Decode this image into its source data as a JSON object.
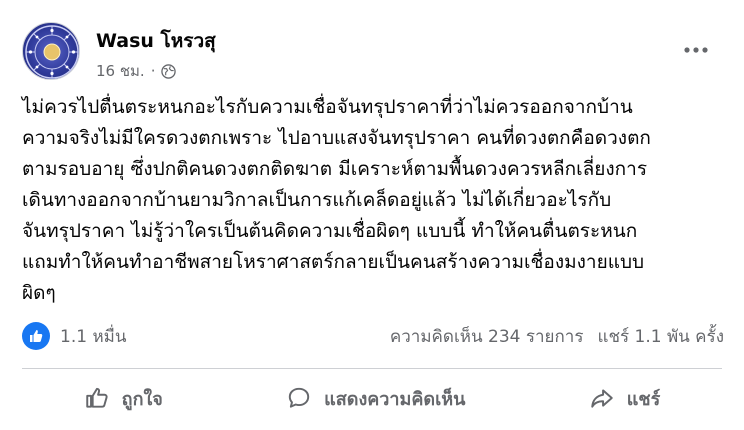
{
  "post": {
    "author": "Wasu โหรวสุ",
    "timestamp": "16 ชม.",
    "meta_separator": "·",
    "privacy_icon": "globe-icon",
    "body_lines": [
      "ไม่ควรไปตื่นตระหนกอะไรกับความเชื่อจันทรุปราคาที่ว่าไม่ควรออกจากบ้าน",
      "ความจริงไม่มีใครดวงตกเพราะ ไปอาบแสงจันทรุปราคา คนที่ดวงตกคือดวงตก",
      "ตามรอบอายุ ซึ่งปกติคนดวงตกติดฆาต มีเคราะห์ตามพื้นดวงควรหลีกเลี่ยงการ",
      "เดินทางออกจากบ้านยามวิกาลเป็นการแก้เคล็ดอยู่แล้ว ไม่ได้เกี่ยวอะไรกับ",
      "จันทรุปราคา ไม่รู้ว่าใครเป็นต้นคิดความเชื่อผิดๆ แบบนี้ ทำให้คนตื่นตระหนก",
      "แถมทำให้คนทำอาชีพสายโหราศาสตร์กลายเป็นคนสร้างความเชื่องมงายแบบ",
      "ผิดๆ"
    ]
  },
  "stats": {
    "reactions": "1.1 หมื่น",
    "comments": "ความคิดเห็น 234 รายการ",
    "shares": "แชร์ 1.1 พัน ครั้ง"
  },
  "actions": {
    "like": "ถูกใจ",
    "comment": "แสดงความคิดเห็น",
    "share": "แชร์"
  },
  "colors": {
    "accent": "#1877f2",
    "secondary_text": "#65676b",
    "primary_text": "#050505"
  }
}
